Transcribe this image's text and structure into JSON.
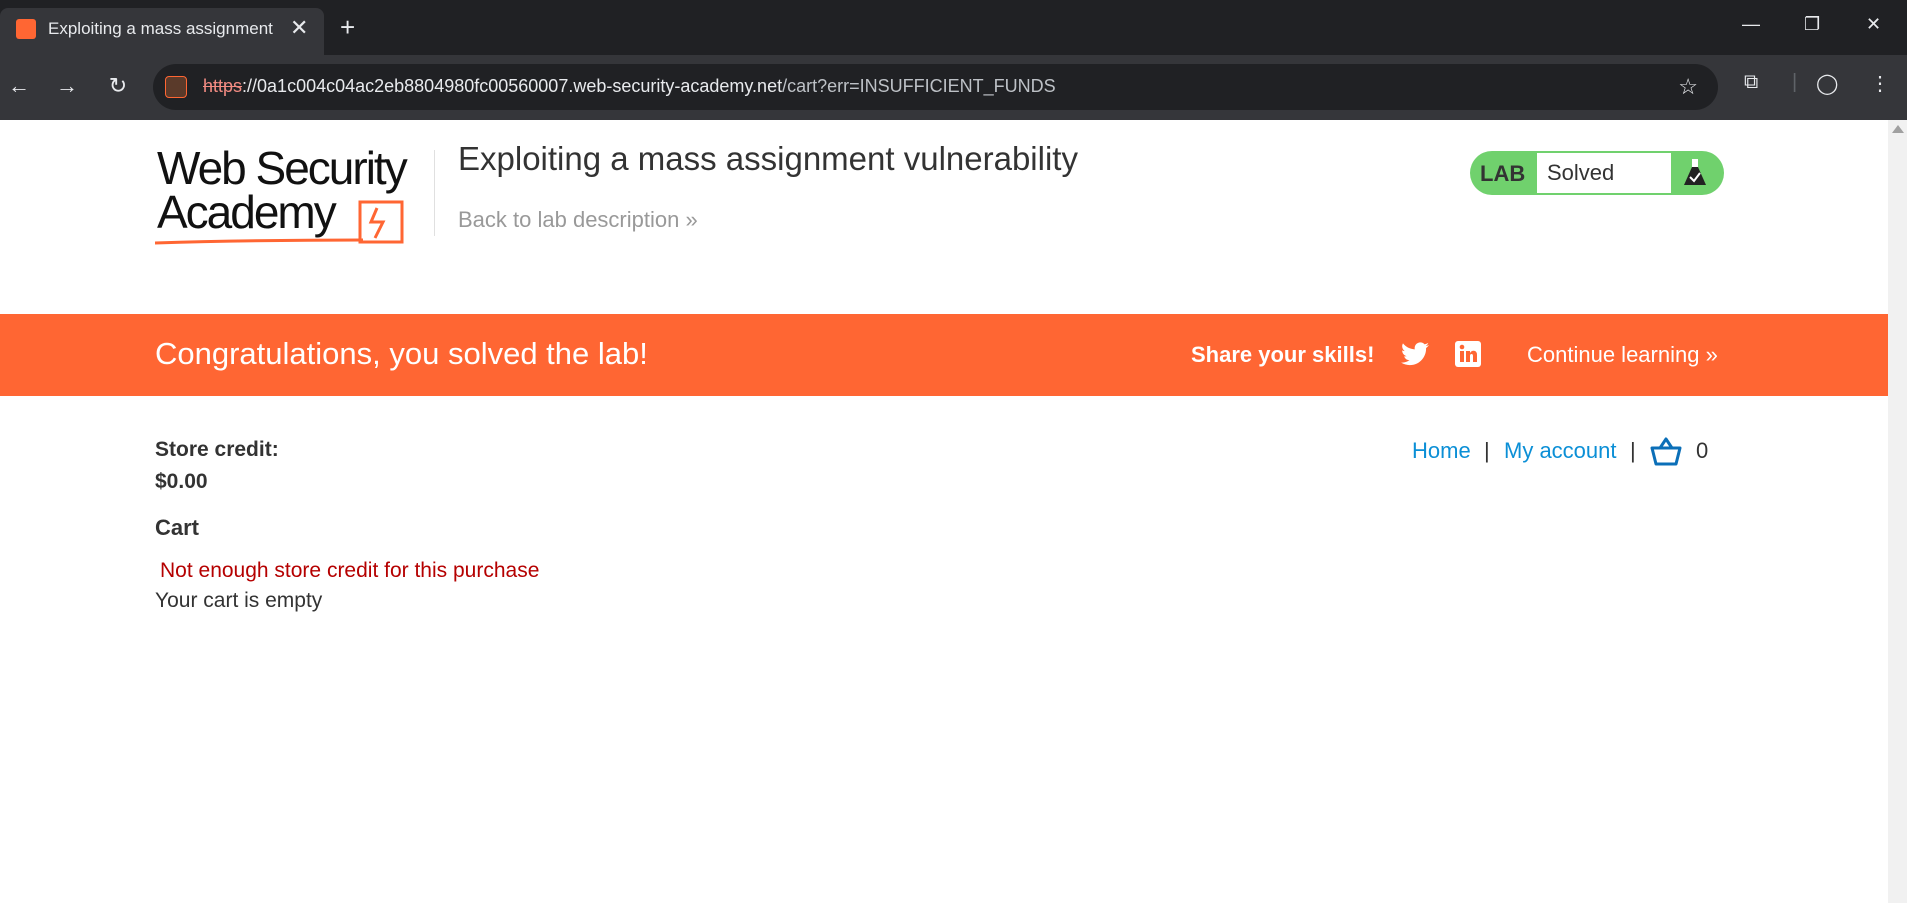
{
  "browser": {
    "tab_title": "Exploiting a mass assignment vulnerability",
    "url_protocol": "https",
    "url_host": "://0a1c004c04ac2eb8804980fc00560007.web-security-academy.net",
    "url_path": "/cart?err=INSUFFICIENT_FUNDS"
  },
  "header": {
    "logo_text": "Web Security Academy",
    "lab_title": "Exploiting a mass assignment vulnerability",
    "back_link": "Back to lab description",
    "lab_label": "LAB",
    "lab_status": "Solved"
  },
  "banner": {
    "message": "Congratulations, you solved the lab!",
    "share": "Share your skills!",
    "continue": "Continue learning"
  },
  "nav": {
    "home": "Home",
    "separator": "|",
    "my_account": "My account",
    "cart_count": "0"
  },
  "main": {
    "store_credit_label": "Store credit:",
    "store_credit_value": "$0.00",
    "cart_heading": "Cart",
    "error": "Not enough store credit for this purchase",
    "empty_message": "Your cart is empty"
  },
  "colors": {
    "accent": "#ff6633",
    "lab_solved": "#70d16d",
    "link": "#0b8fd6",
    "error": "#b50000"
  },
  "icons": [
    "favicon-icon",
    "close-icon",
    "plus-icon",
    "back-icon",
    "forward-icon",
    "reload-icon",
    "star-icon",
    "twitter-icon",
    "linkedin-icon",
    "flask-icon",
    "basket-icon"
  ]
}
